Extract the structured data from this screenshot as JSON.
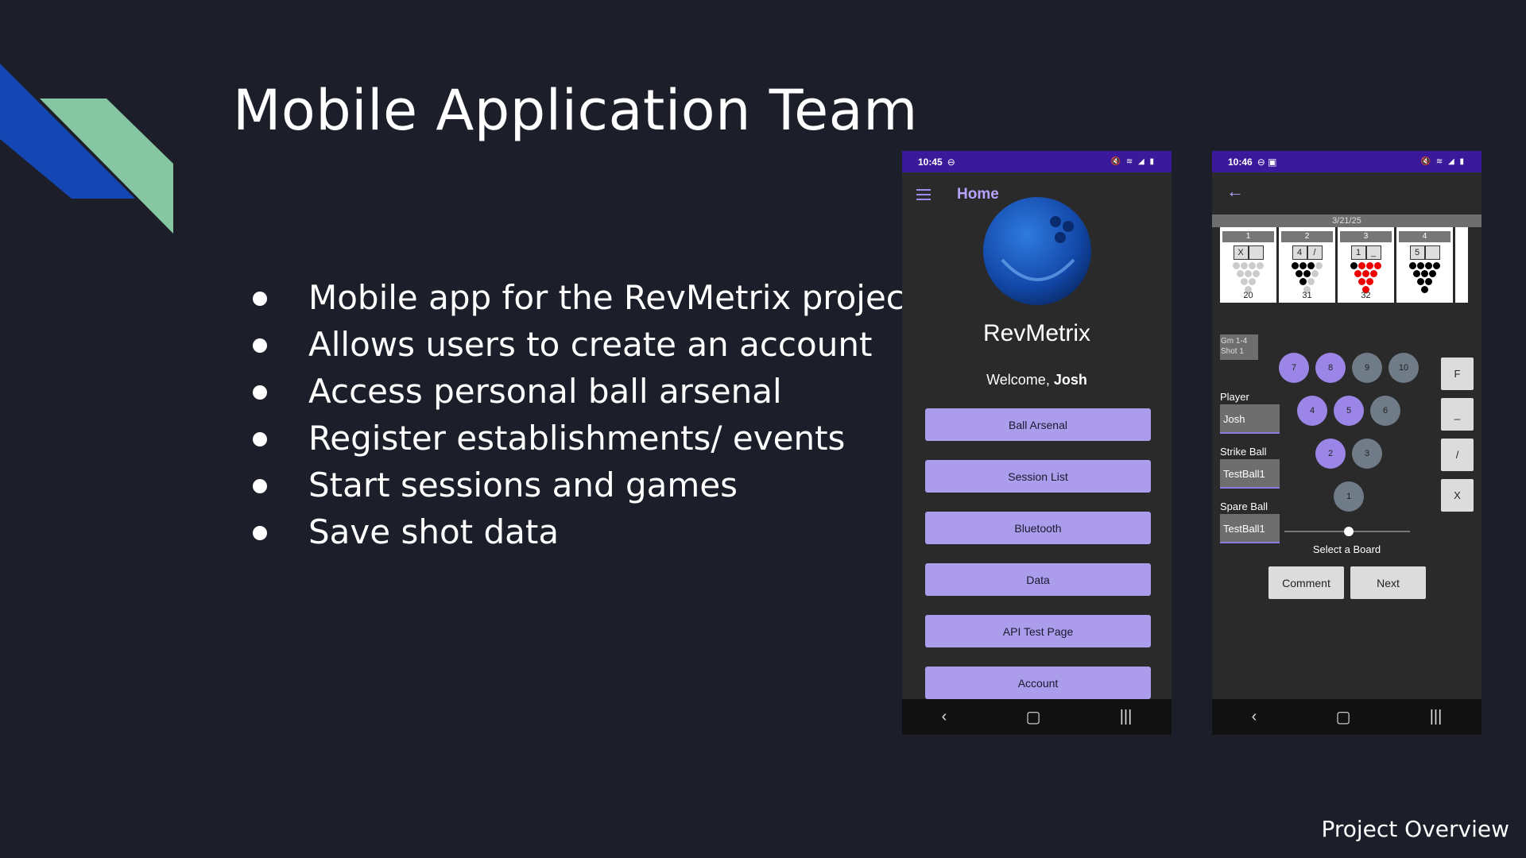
{
  "slide": {
    "title": "Mobile Application Team",
    "bullets": [
      "Mobile app for the RevMetrix project",
      "Allows users to create an account",
      "Access personal ball arsenal",
      "Register establishments/ events",
      "Start sessions and games",
      "Save shot data"
    ],
    "footer": "Project Overview"
  },
  "colors": {
    "background": "#1c1f2a",
    "accent_blue": "#1446b4",
    "accent_green": "#86c6a2",
    "purple": "#ab9cec"
  },
  "phone1": {
    "status_time": "10:45",
    "appbar_title": "Home",
    "app_name": "RevMetrix",
    "welcome_prefix": "Welcome,",
    "welcome_user": "Josh",
    "buttons": [
      "Ball Arsenal",
      "Session List",
      "Bluetooth",
      "Data",
      "API Test Page",
      "Account"
    ]
  },
  "phone2": {
    "status_time": "10:46",
    "date": "3/21/25",
    "frames": [
      {
        "number": "1",
        "box1": "X",
        "box2": "",
        "score": "20"
      },
      {
        "number": "2",
        "box1": "4",
        "box2": "/",
        "score": "31"
      },
      {
        "number": "3",
        "box1": "1",
        "box2": "_",
        "score": "32"
      },
      {
        "number": "4",
        "box1": "5",
        "box2": "",
        "score": ""
      }
    ],
    "game_label_1": "Gm 1-4",
    "game_label_2": "Shot 1",
    "pins": [
      "7",
      "8",
      "9",
      "10",
      "4",
      "5",
      "6",
      "2",
      "3",
      "1"
    ],
    "player_label": "Player",
    "player_value": "Josh",
    "strike_label": "Strike Ball",
    "strike_value": "TestBall1",
    "spare_label": "Spare Ball",
    "spare_value": "TestBall1",
    "keys": [
      "F",
      "_",
      "/",
      "X"
    ],
    "select_board": "Select a Board",
    "comment_label": "Comment",
    "next_label": "Next"
  }
}
